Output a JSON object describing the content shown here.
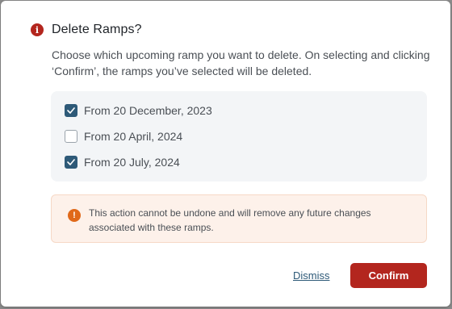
{
  "dialog": {
    "title": "Delete Ramps?",
    "title_icon": "info-icon",
    "description": "Choose which upcoming ramp you want to delete. On selecting and clicking ‘Confirm’, the ramps you’ve selected will be deleted.",
    "options": [
      {
        "label": "From 20 December, 2023",
        "checked": true
      },
      {
        "label": "From 20 April, 2024",
        "checked": false
      },
      {
        "label": "From 20 July, 2024",
        "checked": true
      }
    ],
    "warning": {
      "icon": "alert-icon",
      "text": "This action cannot be undone and will remove any future changes associated with these ramps."
    },
    "dismiss_label": "Dismiss",
    "confirm_label": "Confirm"
  },
  "colors": {
    "danger": "#b3261e",
    "warning_accent": "#e0691a",
    "checkbox_checked": "#2e5a78",
    "warning_bg": "#fdf1ea"
  }
}
